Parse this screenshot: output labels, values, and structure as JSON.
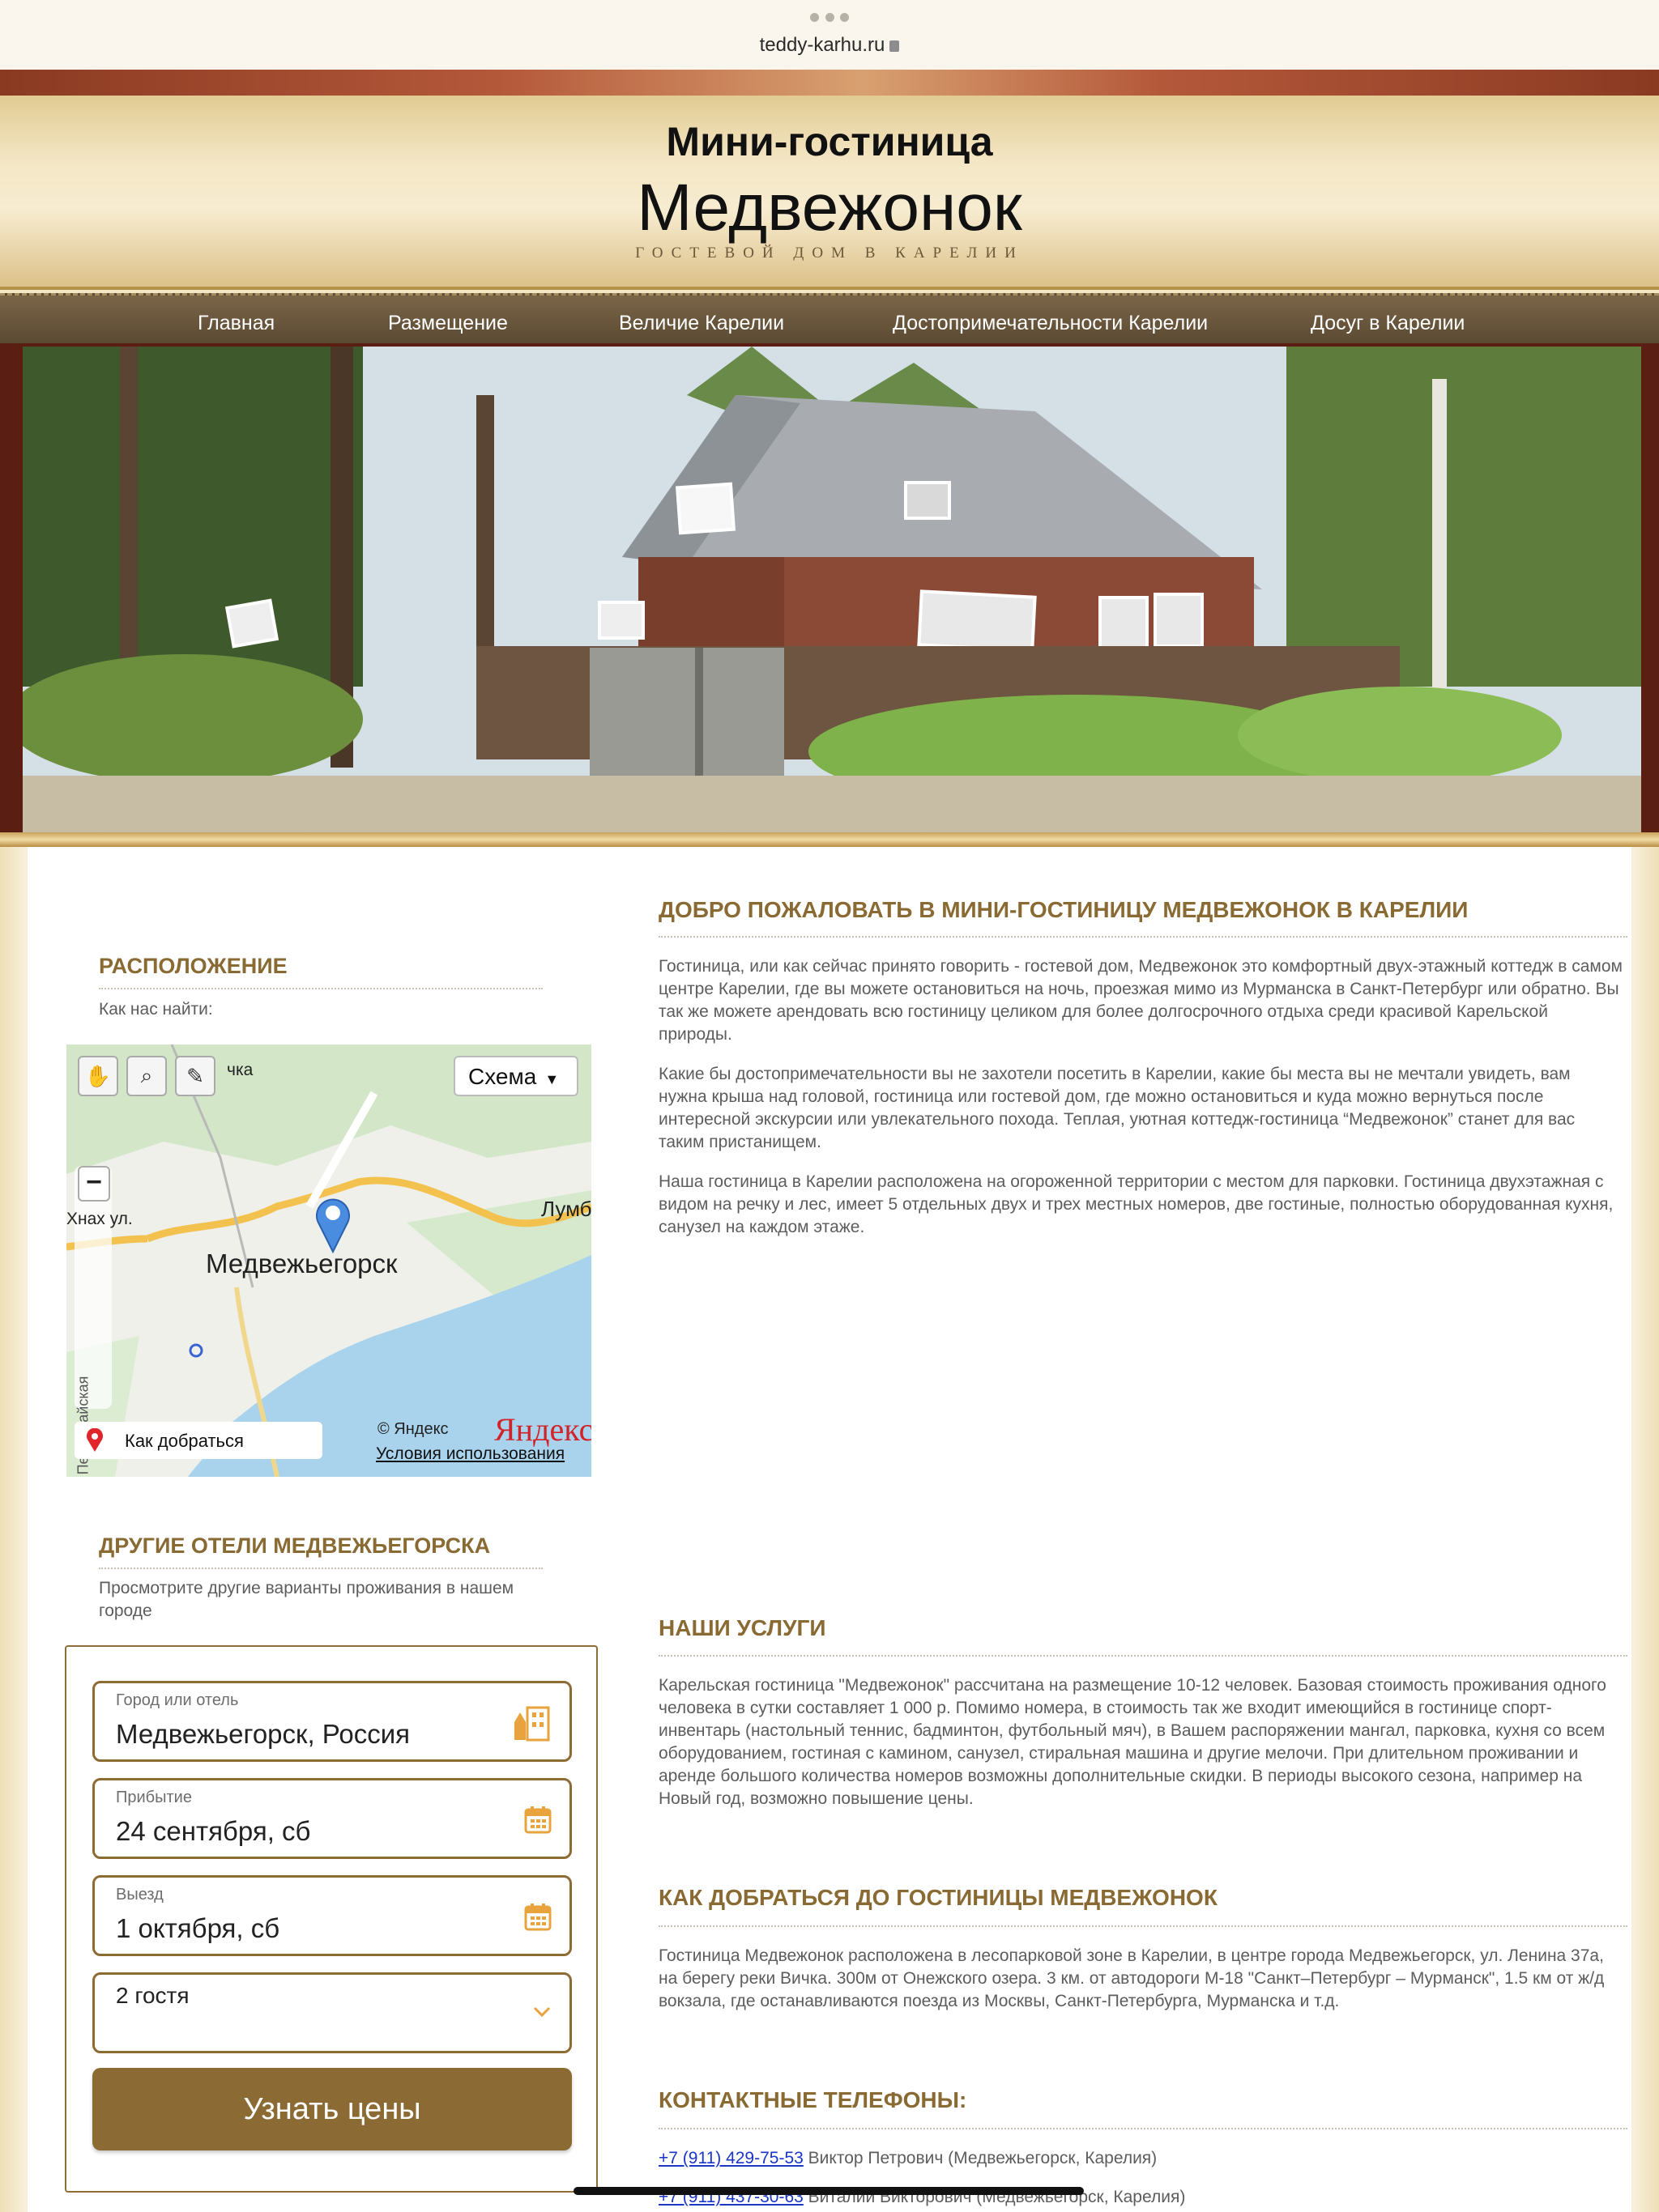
{
  "browser": {
    "url": "teddy-karhu.ru"
  },
  "site": {
    "subtitle": "Мини-гостиница",
    "title": "Медвежонок",
    "tagline": "ГОСТЕВОЙ ДОМ В КАРЕЛИИ"
  },
  "nav": {
    "items": [
      {
        "label": "Главная"
      },
      {
        "label": "Размещение"
      },
      {
        "label": "Величие Карелии"
      },
      {
        "label": "Достопримечательности Карелии"
      },
      {
        "label": "Досуг в Карелии"
      }
    ]
  },
  "sidebar": {
    "location": {
      "heading": "РАСПОЛОЖЕНИЕ",
      "text": "Как нас найти:"
    },
    "map": {
      "scheme_label": "Схема",
      "city_label": "Медвежьегорск",
      "place_left": "Хнах ул.",
      "place_top": "чка",
      "place_right": "Лумб",
      "street_vertical": "Первомайская",
      "copyright": "© Яндекс",
      "brand": "Яндекс",
      "terms": "Условия использования",
      "route_button": "Как добраться"
    },
    "other_hotels": {
      "heading": "ДРУГИЕ ОТЕЛИ МЕДВЕЖЬЕГОРСКА",
      "text": "Просмотрите другие варианты проживания в нашем городе"
    },
    "booking": {
      "city_label": "Город или отель",
      "city_value": "Медвежьегорск, Россия",
      "arrival_label": "Прибытие",
      "arrival_value": "24 сентября, сб",
      "departure_label": "Выезд",
      "departure_value": "1 октября, сб",
      "guests_value": "2 гостя",
      "submit_label": "Узнать цены",
      "accent_color": "#8c6a33",
      "icon_color": "#e8a33c"
    }
  },
  "main": {
    "welcome": {
      "heading": "ДОБРО ПОЖАЛОВАТЬ В МИНИ-ГОСТИНИЦУ МЕДВЕЖОНОК В КАРЕЛИИ",
      "p1": "Гостиница, или как сейчас принято говорить - гостевой дом, Медвежонок это комфортный двух-этажный коттедж в самом центре Карелии, где вы можете остановиться на ночь, проезжая мимо из Мурманска в Санкт-Петербург или обратно. Вы так же можете арендовать всю гостиницу целиком для более долгосрочного отдыха среди красивой Карельской природы.",
      "p2": "Какие бы достопримечательности вы не захотели посетить в Карелии, какие бы места вы не мечтали увидеть, вам нужна крыша над головой, гостиница или гостевой дом, где можно остановиться и куда можно вернуться после интересной экскурсии или увлекательного похода. Теплая, уютная коттедж-гостиница “Медвежонок” станет для вас таким пристанищем.",
      "p3": "Наша гостиница в Карелии расположена на огороженной территории с местом для парковки. Гостиница двухэтажная с видом на речку и лес, имеет 5 отдельных двух и трех местных номеров, две гостиные, полностью оборудованная кухня, санузел на каждом этаже."
    },
    "services": {
      "heading": "НАШИ УСЛУГИ",
      "text": "Карельская гостиница \"Медвежонок\" рассчитана на размещение 10-12 человек. Базовая стоимость проживания одного человека в сутки составляет 1 000 р. Помимо номера, в стоимость так же входит имеющийся в гостинице спорт-инвентарь (настольный теннис, бадминтон, футбольный мяч), в Вашем распоряжении мангал, парковка, кухня со всем оборудованием, гостиная с камином, санузел, стиральная машина и другие мелочи. При длительном проживании и аренде большого количества номеров возможны дополнительные скидки. В периоды высокого сезона, например на Новый год, возможно повышение цены."
    },
    "directions": {
      "heading": "КАК ДОБРАТЬСЯ ДО ГОСТИНИЦЫ МЕДВЕЖОНОК",
      "text": "Гостиница Медвежонок расположена в лесопарковой зоне в Карелии, в центре города Медвежьегорск, ул. Ленина 37а, на берегу реки Вичка. 300м от Онежского озера. 3 км. от автодороги М-18 \"Санкт–Петербург – Мурманск\", 1.5 км от ж/д вокзала, где останавливаются поезда из Москвы, Санкт-Петербурга, Мурманска и т.д."
    },
    "contacts": {
      "heading": "КОНТАКТНЫЕ ТЕЛЕФОНЫ:",
      "phone1": "+7 (911) 429-75-53",
      "name1": " Виктор Петрович (Медвежьегорск, Карелия)",
      "phone2": "+7 (911) 437-30-63",
      "name2": " Виталий Викторович (Медвежьегорск, Карелия)"
    }
  },
  "colors": {
    "heading": "#8a6a33",
    "nav_bg": "#5b4a33",
    "link": "#1a35c9"
  }
}
